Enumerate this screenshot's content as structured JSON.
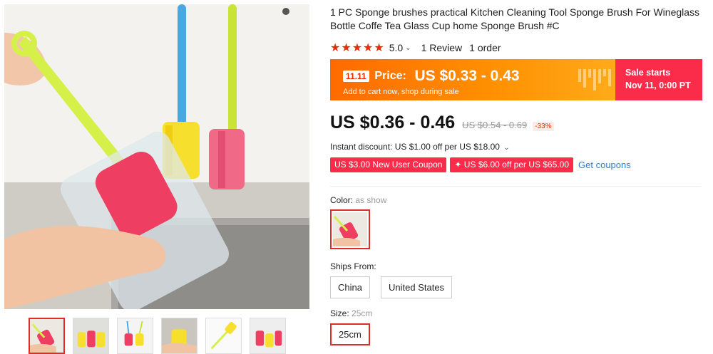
{
  "product": {
    "title": "1 PC Sponge brushes practical Kitchen Cleaning Tool Sponge Brush For Wineglass Bottle Coffe Tea Glass Cup home Sponge Brush #C",
    "stars": "★★★★★",
    "rating": "5.0",
    "reviews": "1 Review",
    "orders": "1 order"
  },
  "promo": {
    "badge": "11.11",
    "label": "Price:",
    "price": "US $0.33 - 0.43",
    "sub": "Add to cart now, shop during sale",
    "sale_title": "Sale starts",
    "sale_date": "Nov 11, 0:00 PT"
  },
  "price": {
    "current": "US $0.36 - 0.46",
    "original": "US $0.54 - 0.69",
    "discount": "-33%"
  },
  "instant_discount": "Instant discount: US $1.00 off per US $18.00",
  "coupons": {
    "items": [
      "US $3.00 New User Coupon",
      "✦ US $6.00 off per US $65.00"
    ],
    "get_label": "Get coupons"
  },
  "options": {
    "color_label": "Color:",
    "color_value": "as show",
    "ships_label": "Ships From:",
    "ships": [
      "China",
      "United States"
    ],
    "size_label": "Size:",
    "size_value": "25cm",
    "sizes": [
      "25cm"
    ]
  },
  "colors": {
    "accent": "#e02b27",
    "promo_orange": "#ff7a00",
    "promo_pink": "#fa2c4a",
    "link": "#2e7dd1"
  },
  "icons": {
    "caret": "chevron-down-icon",
    "star": "star-icon"
  }
}
